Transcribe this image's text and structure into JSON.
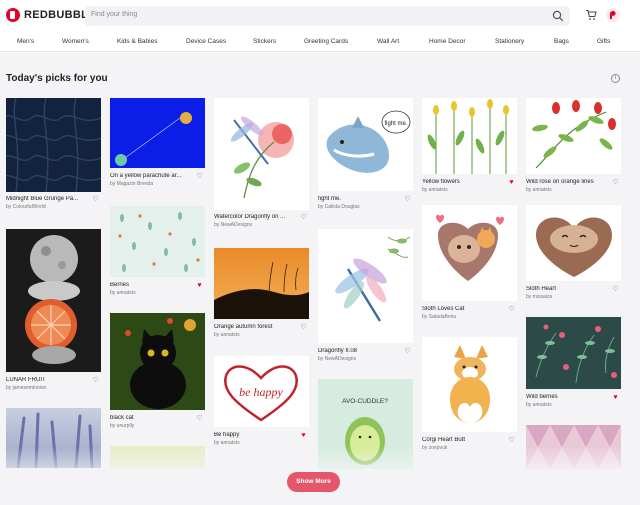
{
  "header": {
    "logo_text": "REDBUBBLE",
    "search_placeholder": "Find your thing"
  },
  "nav": [
    "Men's",
    "Women's",
    "Kids & Babies",
    "Device Cases",
    "Stickers",
    "Greeting Cards",
    "Wall Art",
    "Home Decor",
    "Stationery",
    "Bags",
    "Gifts"
  ],
  "section_title": "Today's picks for you",
  "info_label": "i",
  "show_more": "Show More",
  "cards": [
    {
      "title": "Midnight Blue Grunge Pa...",
      "by": "by ColourfulWorld",
      "liked": false,
      "art": "navy-leaves"
    },
    {
      "title": "LUNAR FRUIT",
      "by": "by jameseminnion",
      "liked": false,
      "art": "lunar-fruit"
    },
    {
      "title": "",
      "by": "",
      "liked": false,
      "art": "lavender"
    },
    {
      "title": "On a yellow parachute ar...",
      "by": "by Magazin Brenda",
      "liked": false,
      "art": "parachute"
    },
    {
      "title": "Berries",
      "by": "by annatsts",
      "liked": true,
      "art": "berries-pattern"
    },
    {
      "title": "black cat",
      "by": "by unurplly",
      "liked": false,
      "art": "black-cat"
    },
    {
      "title": "",
      "by": "",
      "liked": false,
      "art": "green-blur"
    },
    {
      "title": "Watercolor Dragonfly on ...",
      "by": "by NewADesigns",
      "liked": false,
      "art": "dragonfly-flower"
    },
    {
      "title": "Orange autumn forest",
      "by": "by annatsts",
      "liked": false,
      "art": "autumn"
    },
    {
      "title": "Be happy",
      "by": "by annatsts",
      "liked": true,
      "art": "be-happy"
    },
    {
      "title": "fight me.",
      "by": "by Calista Douglas",
      "liked": false,
      "art": "shark"
    },
    {
      "title": "Dragonfly II.08",
      "by": "by NewADesigns",
      "liked": false,
      "art": "dragonfly"
    },
    {
      "title": "",
      "by": "",
      "liked": false,
      "art": "avocado"
    },
    {
      "title": "Yellow flowers",
      "by": "by annatsts",
      "liked": true,
      "art": "yellow-flowers"
    },
    {
      "title": "Sloth Loves Cat",
      "by": "by SatadaBonu",
      "liked": false,
      "art": "sloth-cat"
    },
    {
      "title": "Corgi Heart Butt",
      "by": "by zoepvuk",
      "liked": false,
      "art": "corgi"
    },
    {
      "title": "Wild rose on orange lines",
      "by": "by annatsts",
      "liked": false,
      "art": "wild-rose"
    },
    {
      "title": "Sloth Heart",
      "by": "by missaiza",
      "liked": false,
      "art": "sloth-heart"
    },
    {
      "title": "Wild berries",
      "by": "by annatsts",
      "liked": true,
      "art": "wild-berries"
    },
    {
      "title": "",
      "by": "",
      "liked": false,
      "art": "triangles"
    }
  ],
  "art_texts": {
    "shark_bubble": "fight me.",
    "be_happy": "be happy",
    "avocado": "AVO-CUDDLE?"
  }
}
